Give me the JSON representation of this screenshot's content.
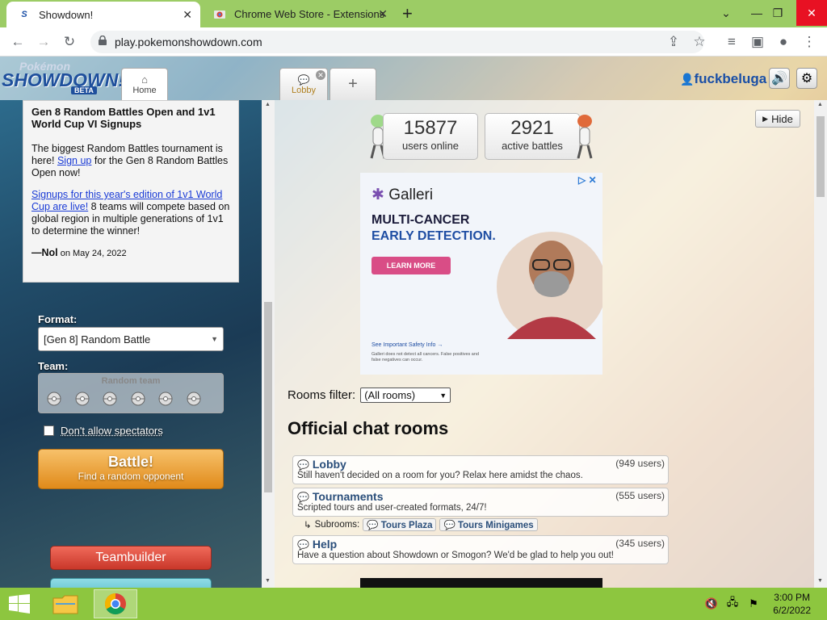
{
  "browser": {
    "tabs": [
      {
        "title": "Showdown!",
        "active": true
      },
      {
        "title": "Chrome Web Store - Extensions",
        "active": false
      }
    ],
    "new_tab": "+",
    "url": "play.pokemonshowdown.com"
  },
  "ps": {
    "logo_top": "Pokémon",
    "logo_main": "SHOWDOWN!",
    "logo_badge": "BETA",
    "tabs": [
      {
        "label": "Home"
      },
      {
        "label": "Lobby"
      }
    ],
    "add_tab": "+",
    "username": "fuckbeluga"
  },
  "news": {
    "title": "Gen 8 Random Battles Open and 1v1 World Cup VI Signups",
    "p1_before": "The biggest Random Battles tournament is here! ",
    "p1_link": "Sign up",
    "p1_after": " for the Gen 8 Random Battles Open now!",
    "p2_link": "Signups for this year's edition of 1v1 World Cup are live!",
    "p2_after": " 8 teams will compete based on global region in multiple generations of 1v1 to determine the winner!",
    "author": "—Nol",
    "date": "on May 24, 2022"
  },
  "battle_form": {
    "format_label": "Format:",
    "format_value": "[Gen 8] Random Battle",
    "team_label": "Team:",
    "team_value": "Random team",
    "spectators_label": "Don't allow spectators",
    "battle_label": "Battle!",
    "battle_sub": "Find a random opponent",
    "teambuilder_label": "Teambuilder"
  },
  "main": {
    "hide_label": "Hide",
    "users_online": "15877",
    "users_online_label": "users online",
    "active_battles": "2921",
    "active_battles_label": "active battles",
    "ad": {
      "brand": "Galleri",
      "headline1": "MULTI-CANCER",
      "headline2": "EARLY DETECTION.",
      "cta": "LEARN MORE",
      "safety": "See Important Safety Info →",
      "fine_print": "Galleri does not detect all cancers. False positives and false negatives can occur."
    },
    "rooms_filter_label": "Rooms filter:",
    "rooms_filter_value": "(All rooms)",
    "official_heading": "Official chat rooms",
    "rooms": [
      {
        "name": "Lobby",
        "users": "(949 users)",
        "desc": "Still haven't decided on a room for you? Relax here amidst the chaos."
      },
      {
        "name": "Tournaments",
        "users": "(555 users)",
        "desc": "Scripted tours and user-created formats, 24/7!"
      },
      {
        "name": "Help",
        "users": "(345 users)",
        "desc": "Have a question about Showdown or Smogon? We'd be glad to help you out!"
      }
    ],
    "subrooms_label": "Subrooms:",
    "subrooms": [
      "Tours Plaza",
      "Tours Minigames"
    ]
  },
  "taskbar": {
    "time": "3:00 PM",
    "date": "6/2/2022"
  },
  "colors": {
    "tabstrip": "#9ccc65",
    "taskbar": "#8dc63f",
    "username": "#1a4fa6",
    "battle": "#e08a1a",
    "teambuilder": "#c9372a"
  }
}
